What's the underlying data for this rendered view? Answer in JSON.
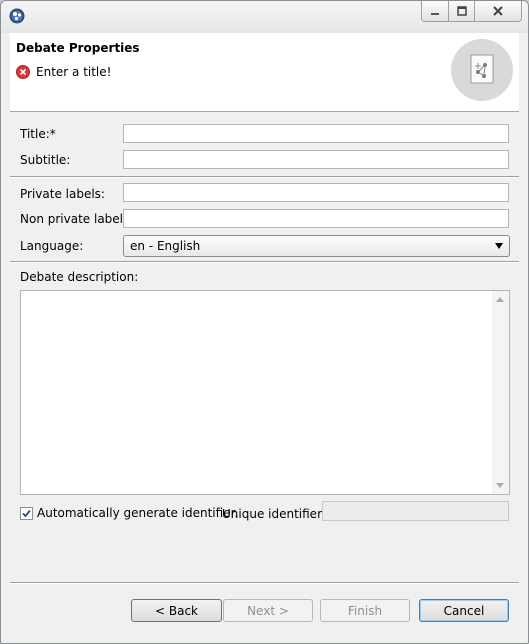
{
  "header": {
    "title": "Debate Properties",
    "message": "Enter a title!"
  },
  "form": {
    "title_label": "Title:*",
    "title_value": "",
    "subtitle_label": "Subtitle:",
    "subtitle_value": "",
    "private_labels_label": "Private labels:",
    "private_labels_value": "",
    "non_private_labels_label": "Non private labels:",
    "non_private_labels_value": "",
    "language_label": "Language:",
    "language_value": "en - English",
    "description_label": "Debate description:",
    "description_value": "",
    "auto_id_label": "Automatically generate identifier.",
    "auto_id_checked": true,
    "unique_id_label": "Unique identifier:*",
    "unique_id_value": ""
  },
  "buttons": {
    "back": "< Back",
    "next": "Next >",
    "finish": "Finish",
    "cancel": "Cancel"
  },
  "icons": {
    "app": "eclipse-icon",
    "error": "error-icon",
    "wizard": "wizard-banner-icon"
  },
  "colors": {
    "error_red": "#d9383a",
    "default_button_border": "#3c7fb1"
  }
}
